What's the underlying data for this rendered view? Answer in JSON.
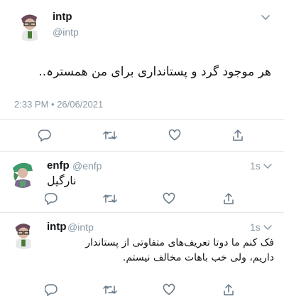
{
  "main_tweet": {
    "name": "intp",
    "handle": "@intp",
    "text": "هر موجود گرد و پستانداری برای من همسترہ..",
    "timestamp": "2:33 PM • 26/06/2021"
  },
  "reply1": {
    "name": "enfp",
    "handle": "@enfp",
    "time": "1s",
    "text": "نارگیل"
  },
  "reply2": {
    "name": "intp",
    "handle": "@intp",
    "time": "1s",
    "text_line1": "فک کنم ما دوتا تعریف‌های متفاوتی از پستاندار",
    "text_line2": "داریم، ولی خب باهات مخالف نیستم."
  },
  "icons": [
    "reply-icon",
    "retweet-icon",
    "like-icon",
    "share-icon",
    "chevron-down-icon"
  ],
  "colors": {
    "icon_gray": "#657786",
    "handle_gray": "#8899a6",
    "divider": "#e1e8ed"
  }
}
